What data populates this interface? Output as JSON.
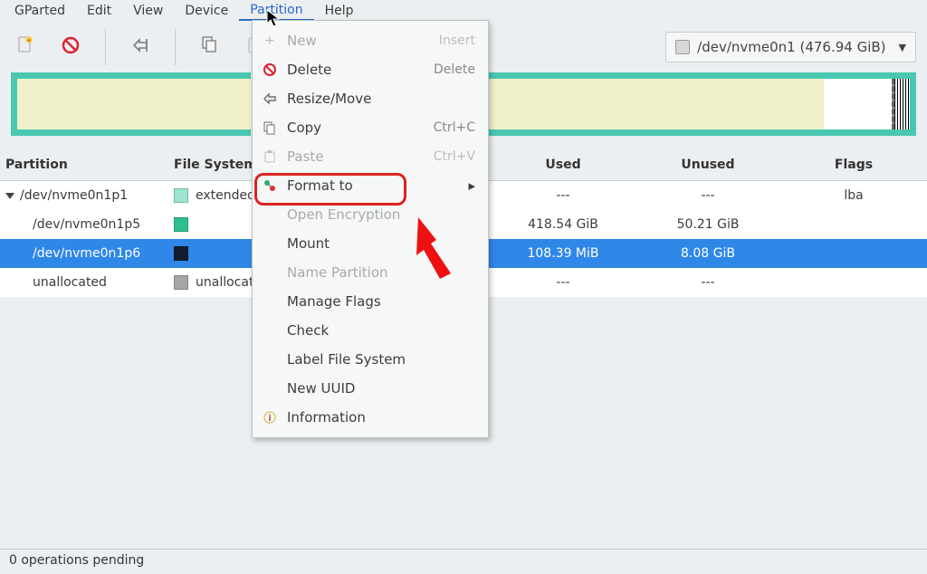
{
  "menubar": {
    "items": [
      "GParted",
      "Edit",
      "View",
      "Device",
      "Partition",
      "Help"
    ],
    "open_index": 4
  },
  "device_picker": {
    "label": "/dev/nvme0n1 (476.94 GiB)"
  },
  "columns": {
    "partition": "Partition",
    "fs": "File System",
    "used": "Used",
    "unused": "Unused",
    "flags": "Flags"
  },
  "rows": [
    {
      "name": "/dev/nvme0n1p1",
      "fs": "extended",
      "swatch": "#9be5d2",
      "indent": 0,
      "tri": true,
      "used": "---",
      "unused": "---",
      "flags": "lba"
    },
    {
      "name": "/dev/nvme0n1p5",
      "fs": "",
      "swatch": "#2fbf8e",
      "indent": 1,
      "tri": false,
      "used": "418.54 GiB",
      "unused": "50.21 GiB",
      "flags": ""
    },
    {
      "name": "/dev/nvme0n1p6",
      "fs": "",
      "swatch": "#141b2e",
      "indent": 1,
      "tri": false,
      "used": "108.39 MiB",
      "unused": "8.08 GiB",
      "flags": "",
      "selected": true
    },
    {
      "name": "unallocated",
      "fs": "unallocated",
      "swatch": "#a5a7a7",
      "indent": 1,
      "tri": false,
      "used": "---",
      "unused": "---",
      "flags": ""
    }
  ],
  "dropdown": {
    "items": [
      {
        "label": "New",
        "kb": "Insert",
        "disabled": true,
        "icon": "plus"
      },
      {
        "label": "Delete",
        "kb": "Delete",
        "disabled": false,
        "icon": "delete"
      },
      {
        "label": "Resize/Move",
        "kb": "",
        "disabled": false,
        "icon": "resize"
      },
      {
        "label": "Copy",
        "kb": "Ctrl+C",
        "disabled": false,
        "icon": "copy"
      },
      {
        "label": "Paste",
        "kb": "Ctrl+V",
        "disabled": true,
        "icon": "paste"
      },
      {
        "label": "Format to",
        "kb": "",
        "disabled": false,
        "icon": "format",
        "submenu": true,
        "highlight": true
      },
      {
        "label": "Open Encryption",
        "kb": "",
        "disabled": true
      },
      {
        "label": "Mount",
        "kb": "",
        "disabled": false
      },
      {
        "label": "Name Partition",
        "kb": "",
        "disabled": true
      },
      {
        "label": "Manage Flags",
        "kb": "",
        "disabled": false
      },
      {
        "label": "Check",
        "kb": "",
        "disabled": false
      },
      {
        "label": "Label File System",
        "kb": "",
        "disabled": false
      },
      {
        "label": "New UUID",
        "kb": "",
        "disabled": false
      },
      {
        "label": "Information",
        "kb": "",
        "disabled": false,
        "icon": "info"
      }
    ]
  },
  "statusbar": {
    "text": "0 operations pending"
  }
}
